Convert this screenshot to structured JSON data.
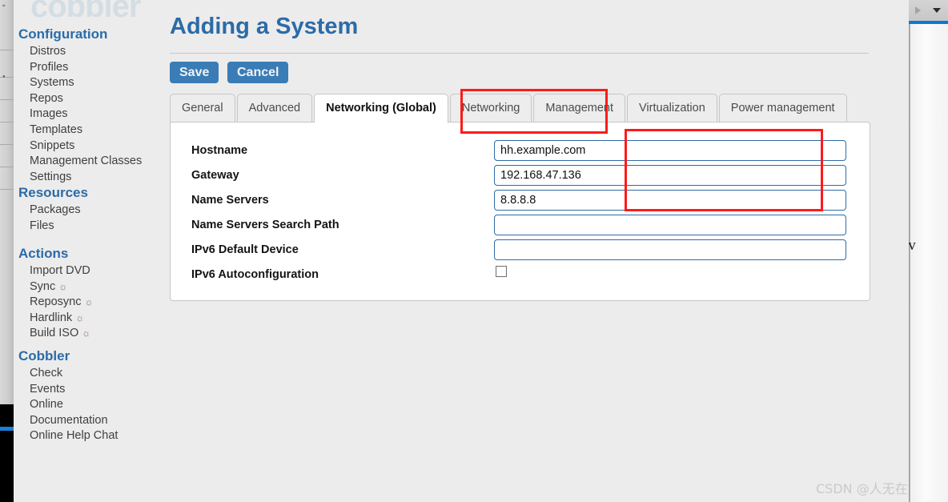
{
  "logo": {
    "text": "cobbler"
  },
  "sidebar": {
    "groups": [
      {
        "heading": "Configuration",
        "items": [
          {
            "label": "Distros",
            "icon": ""
          },
          {
            "label": "Profiles",
            "icon": ""
          },
          {
            "label": "Systems",
            "icon": ""
          },
          {
            "label": "Repos",
            "icon": ""
          },
          {
            "label": "Images",
            "icon": ""
          },
          {
            "label": "Templates",
            "icon": ""
          },
          {
            "label": "Snippets",
            "icon": ""
          },
          {
            "label": "Management Classes",
            "icon": ""
          },
          {
            "label": "Settings",
            "icon": ""
          }
        ]
      },
      {
        "heading": "Resources",
        "items": [
          {
            "label": "Packages",
            "icon": ""
          },
          {
            "label": "Files",
            "icon": ""
          }
        ]
      },
      {
        "heading": "Actions",
        "items": [
          {
            "label": "Import DVD",
            "icon": ""
          },
          {
            "label": "Sync",
            "icon": "☼"
          },
          {
            "label": "Reposync",
            "icon": "☼"
          },
          {
            "label": "Hardlink",
            "icon": "☼"
          },
          {
            "label": "Build ISO",
            "icon": "☼"
          }
        ]
      },
      {
        "heading": "Cobbler",
        "items": [
          {
            "label": "Check",
            "icon": ""
          },
          {
            "label": "Events",
            "icon": ""
          },
          {
            "label": "Online",
            "icon": ""
          },
          {
            "label": "Documentation",
            "icon": ""
          },
          {
            "label": "Online Help Chat",
            "icon": ""
          }
        ]
      }
    ]
  },
  "main": {
    "title": "Adding a System",
    "save_label": "Save",
    "cancel_label": "Cancel",
    "tabs": [
      {
        "label": "General",
        "active": false
      },
      {
        "label": "Advanced",
        "active": false
      },
      {
        "label": "Networking (Global)",
        "active": true
      },
      {
        "label": "Networking",
        "active": false
      },
      {
        "label": "Management",
        "active": false
      },
      {
        "label": "Virtualization",
        "active": false
      },
      {
        "label": "Power management",
        "active": false
      }
    ],
    "fields": [
      {
        "label": "Hostname",
        "value": "hh.example.com",
        "placeholder": "",
        "type": "text"
      },
      {
        "label": "Gateway",
        "value": "192.168.47.136",
        "placeholder": "",
        "type": "text"
      },
      {
        "label": "Name Servers",
        "value": "8.8.8.8",
        "placeholder": "",
        "type": "text"
      },
      {
        "label": "Name Servers Search Path",
        "value": "",
        "placeholder": "",
        "type": "text"
      },
      {
        "label": "IPv6 Default Device",
        "value": "",
        "placeholder": "",
        "type": "text"
      },
      {
        "label": "IPv6 Autoconfiguration",
        "value": "",
        "placeholder": "",
        "type": "checkbox",
        "checked": false
      }
    ]
  },
  "annotations": {
    "highlight_color": "#ff1a1a",
    "tab_highlight_target": "Networking (Global)",
    "field_highlight_targets": [
      "Hostname",
      "Gateway",
      "Name Servers"
    ]
  },
  "browser_chrome": {
    "right_fragment_slash": "/",
    "right_fragment_text": "v",
    "play_icon": "play-triangle-icon",
    "caret_icon": "chevron-down-icon"
  },
  "watermark": {
    "text": "CSDN @人无在始终"
  },
  "colors": {
    "accent_blue": "#2b6ba8",
    "button_blue": "#3a7cb5",
    "input_border": "#2e6ca4",
    "highlight_red": "#ff1a1a",
    "page_bg": "#ececec"
  }
}
